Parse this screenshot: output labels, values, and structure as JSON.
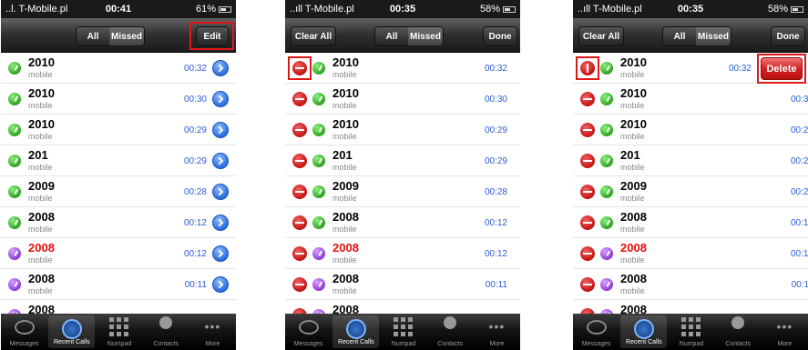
{
  "screens": [
    {
      "status": {
        "carrier": "..l. T-Mobile.pl",
        "time": "00:41",
        "battery": "61%"
      },
      "nav": {
        "all": "All",
        "missed": "Missed",
        "right": "Edit"
      }
    },
    {
      "status": {
        "carrier": "..ıll T-Mobile.pl",
        "time": "00:35",
        "battery": "58%"
      },
      "nav": {
        "left": "Clear All",
        "all": "All",
        "missed": "Missed",
        "right": "Done"
      }
    },
    {
      "status": {
        "carrier": "..ıll T-Mobile.pl",
        "time": "00:35",
        "battery": "58%"
      },
      "nav": {
        "left": "Clear All",
        "all": "All",
        "missed": "Missed",
        "right": "Done"
      },
      "delete_label": "Delete"
    }
  ],
  "calls": [
    {
      "name": "2010",
      "type": "mobile",
      "time": "00:32",
      "missed": false,
      "icon": "outgoing-call-icon",
      "color": "#2ea51f"
    },
    {
      "name": "2010",
      "type": "mobile",
      "time": "00:30",
      "missed": false,
      "icon": "outgoing-call-icon",
      "color": "#2ea51f"
    },
    {
      "name": "2010",
      "type": "mobile",
      "time": "00:29",
      "missed": false,
      "icon": "outgoing-call-icon",
      "color": "#2ea51f"
    },
    {
      "name": "201",
      "type": "mobile",
      "time": "00:29",
      "missed": false,
      "icon": "outgoing-call-icon",
      "color": "#2ea51f"
    },
    {
      "name": "2009",
      "type": "mobile",
      "time": "00:28",
      "missed": false,
      "icon": "outgoing-call-icon",
      "color": "#2ea51f"
    },
    {
      "name": "2008",
      "type": "mobile",
      "time": "00:12",
      "missed": false,
      "icon": "outgoing-call-icon",
      "color": "#2ea51f"
    },
    {
      "name": "2008",
      "type": "mobile",
      "time": "00:12",
      "missed": true,
      "icon": "incoming-call-icon",
      "color": "#8e3ad6"
    },
    {
      "name": "2008",
      "type": "mobile",
      "time": "00:11",
      "missed": false,
      "icon": "incoming-call-icon",
      "color": "#8e3ad6"
    },
    {
      "name": "2008",
      "type": "",
      "time": "",
      "missed": false,
      "icon": "incoming-call-icon",
      "color": "#8e3ad6"
    }
  ],
  "tabs": [
    {
      "label": "Messages",
      "icon": "messages-icon"
    },
    {
      "label": "Recent Calls",
      "icon": "clock-icon",
      "selected": true
    },
    {
      "label": "Numpad",
      "icon": "keypad-icon"
    },
    {
      "label": "Contacts",
      "icon": "contacts-icon"
    },
    {
      "label": "More",
      "icon": "more-icon"
    }
  ]
}
